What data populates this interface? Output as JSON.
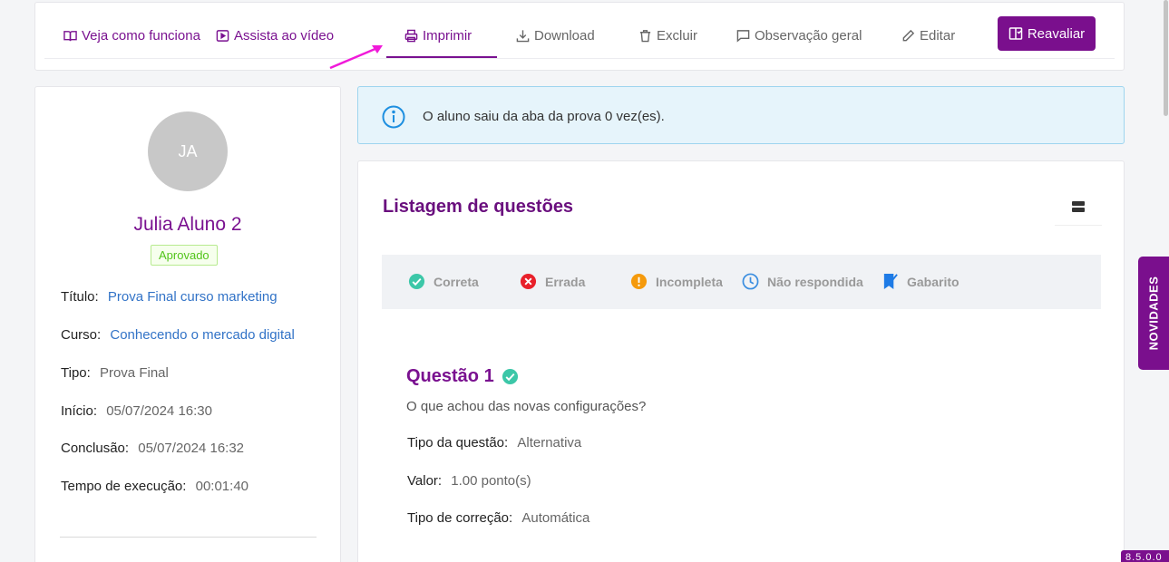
{
  "toolbar": {
    "how_it_works": "Veja como funciona",
    "watch_video": "Assista ao vídeo",
    "print": "Imprimir",
    "download": "Download",
    "delete": "Excluir",
    "general_note": "Observação geral",
    "edit": "Editar",
    "reevaluate": "Reavaliar",
    "active_tab": "Imprimir"
  },
  "student": {
    "initials": "JA",
    "name": "Julia Aluno 2",
    "status": "Aprovado",
    "fields": [
      {
        "label": "Título",
        "value": "Prova Final curso marketing"
      },
      {
        "label": "Curso",
        "value": "Conhecendo o mercado digital"
      },
      {
        "label": "Tipo",
        "value": "Prova Final"
      },
      {
        "label": "Início",
        "value": "05/07/2024 16:30"
      },
      {
        "label": "Conclusão",
        "value": "05/07/2024 16:32"
      },
      {
        "label": "Tempo de execução",
        "value": "00:01:40"
      }
    ]
  },
  "alert": {
    "message": "O aluno saiu da aba da prova 0 vez(es)."
  },
  "questions": {
    "title": "Listagem de questões",
    "legend": [
      "Correta",
      "Errada",
      "Incompleta",
      "Não respondida",
      "Gabarito"
    ],
    "items": [
      {
        "title": "Questão 1",
        "status": "correta",
        "text": "O que achou das novas configurações?",
        "fields": [
          {
            "label": "Tipo da questão",
            "value": "Alternativa"
          },
          {
            "label": "Valor",
            "value": "1.00 ponto(s)"
          },
          {
            "label": "Tipo de correção",
            "value": "Automática"
          }
        ]
      }
    ]
  },
  "side": {
    "news": "NOVIDADES",
    "version": "8.5.0.0"
  },
  "colors": {
    "brand": "#7a0f8d",
    "correct": "#3cc7a8",
    "wrong": "#e8202a",
    "incomplete": "#f59a0c",
    "unanswered": "#3b8ee0",
    "answer_key": "#1e7be6",
    "approved": "#52c41a"
  }
}
